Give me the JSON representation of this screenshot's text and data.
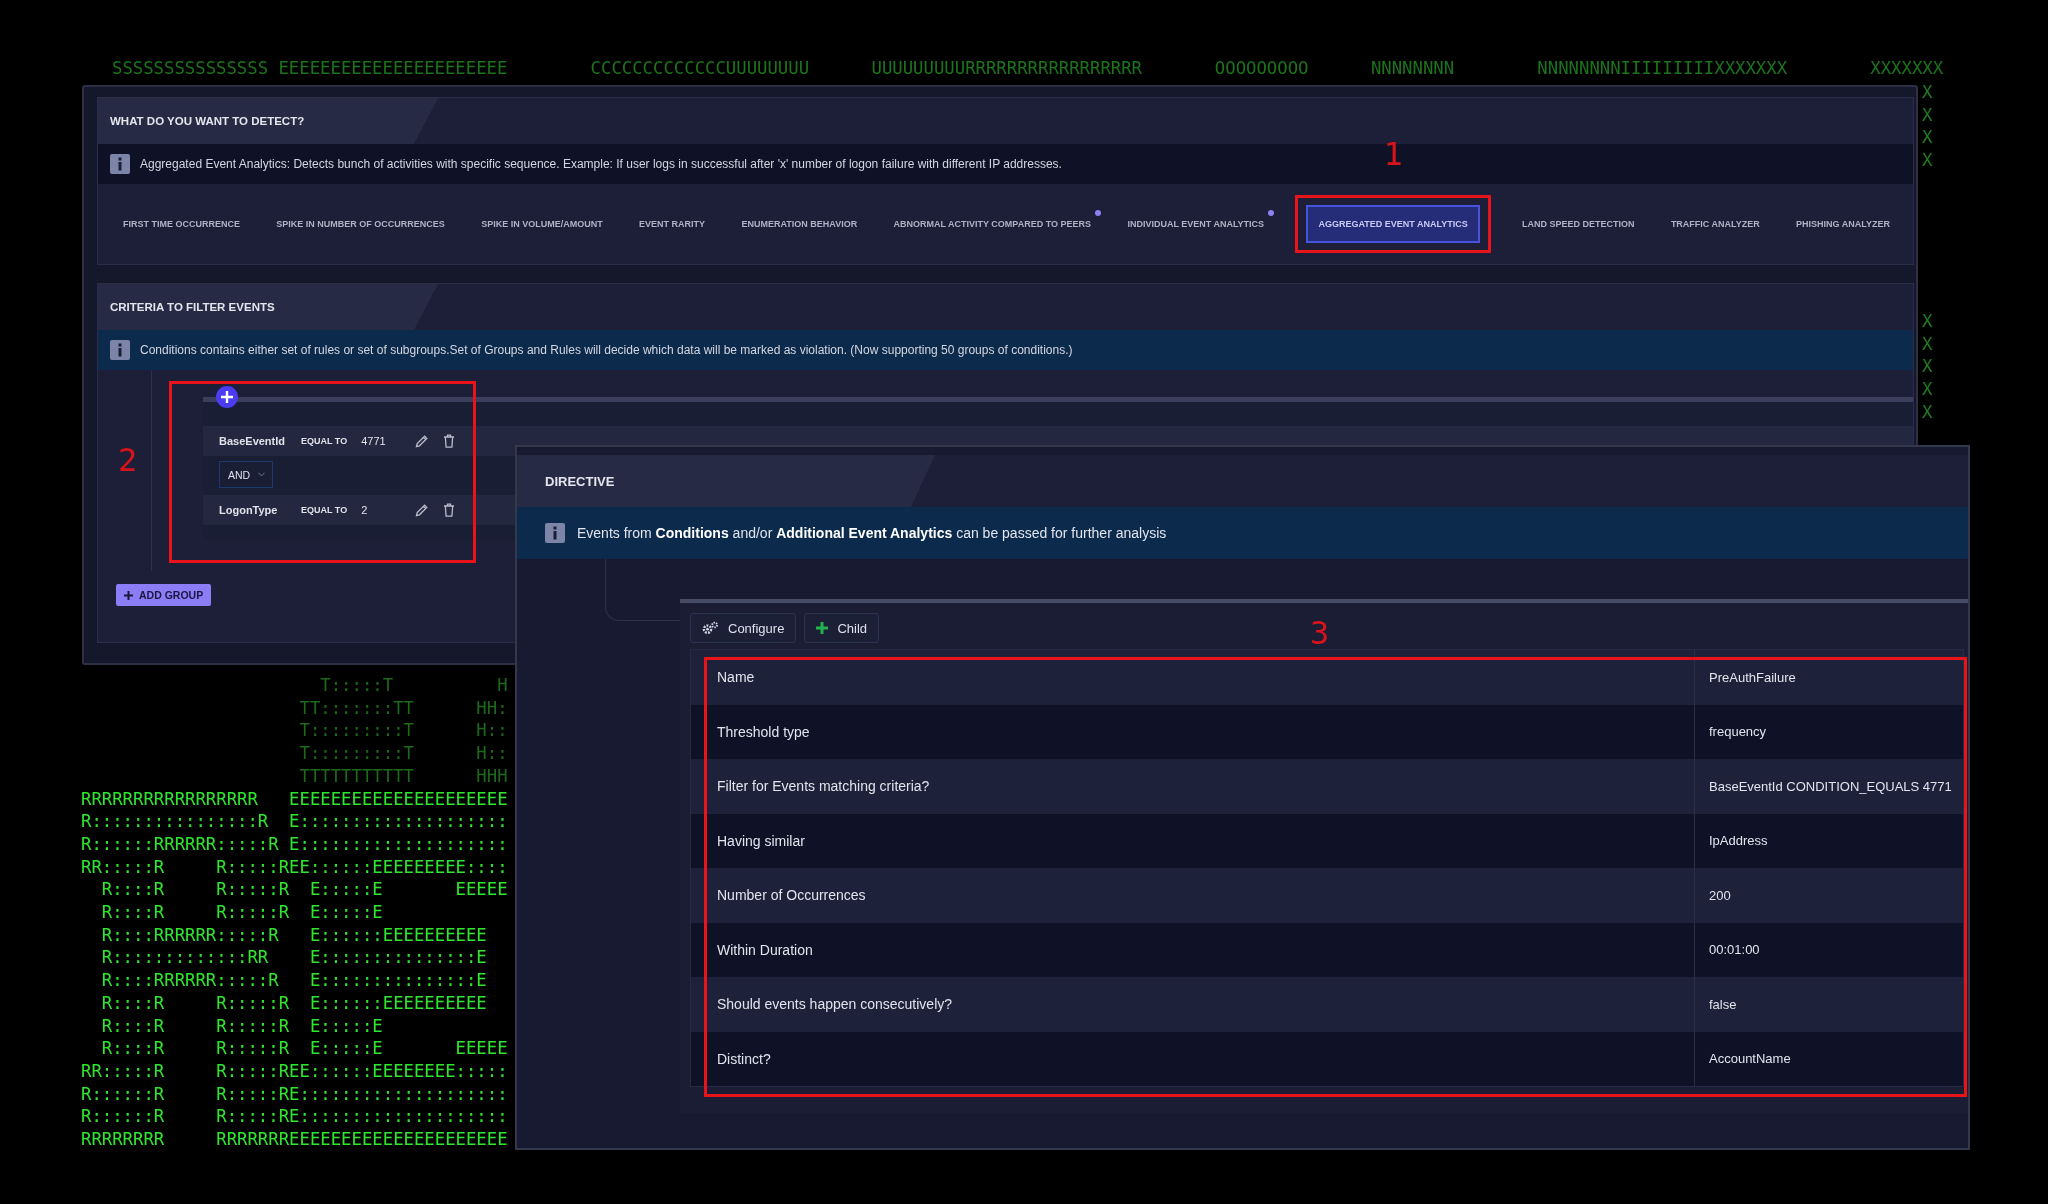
{
  "background_art": {
    "top_row": "SSSSSSSSSSSSSSS EEEEEEEEEEEEEEEEEEEEEE        CCCCCCCCCCCCCUUUUUUUU      UUUUUUUUURRRRRRRRRRRRRRRRR       OOOOOOOOO      NNNNNNNN        NNNNNNNNIIIIIIIIIXXXXXXX        XXXXXXX",
    "x_column_upper": [
      "X",
      "X",
      "X",
      "X"
    ],
    "x_column_lower": [
      "X",
      "X",
      "X",
      "X",
      "X"
    ],
    "block": [
      {
        "text": "                       T:::::T          H",
        "dim": true
      },
      {
        "text": "                     TT:::::::TT      HH:",
        "dim": true
      },
      {
        "text": "                     T:::::::::T      H::",
        "dim": true
      },
      {
        "text": "                     T:::::::::T      H::",
        "dim": true
      },
      {
        "text": "                     TTTTTTTTTTT      HHH",
        "dim": true
      },
      {
        "text": "RRRRRRRRRRRRRRRRR   EEEEEEEEEEEEEEEEEEEEE",
        "dim": false
      },
      {
        "text": "R::::::::::::::::R  E::::::::::::::::::::",
        "dim": false
      },
      {
        "text": "R::::::RRRRRR:::::R E::::::::::::::::::::",
        "dim": false
      },
      {
        "text": "RR:::::R     R:::::REE::::::EEEEEEEEE::::",
        "dim": false
      },
      {
        "text": "  R::::R     R:::::R  E:::::E       EEEEE",
        "dim": false
      },
      {
        "text": "  R::::R     R:::::R  E:::::E",
        "dim": false
      },
      {
        "text": "  R::::RRRRRR:::::R   E::::::EEEEEEEEEE",
        "dim": false
      },
      {
        "text": "  R:::::::::::::RR    E:::::::::::::::E",
        "dim": false
      },
      {
        "text": "  R::::RRRRRR:::::R   E:::::::::::::::E",
        "dim": false
      },
      {
        "text": "  R::::R     R:::::R  E::::::EEEEEEEEEE",
        "dim": false
      },
      {
        "text": "  R::::R     R:::::R  E:::::E",
        "dim": false
      },
      {
        "text": "  R::::R     R:::::R  E:::::E       EEEEE",
        "dim": false
      },
      {
        "text": "RR:::::R     R:::::REE::::::EEEEEEEE:::::",
        "dim": false
      },
      {
        "text": "R::::::R     R:::::RE::::::::::::::::::::",
        "dim": false
      },
      {
        "text": "R::::::R     R:::::RE::::::::::::::::::::",
        "dim": false
      },
      {
        "text": "RRRRRRRR     RRRRRRREEEEEEEEEEEEEEEEEEEEE",
        "dim": false
      }
    ]
  },
  "detect_window": {
    "detect_section": {
      "title": "WHAT DO YOU WANT TO DETECT?",
      "info": "Aggregated Event Analytics: Detects bunch of activities with specific sequence. Example: If user logs in successful after 'x' number of logon failure with different IP addresses.",
      "callout": "1",
      "tabs": [
        {
          "label": "FIRST TIME OCCURRENCE",
          "selected": false,
          "dot": false
        },
        {
          "label": "SPIKE IN NUMBER OF OCCURRENCES",
          "selected": false,
          "dot": false
        },
        {
          "label": "SPIKE IN VOLUME/AMOUNT",
          "selected": false,
          "dot": false
        },
        {
          "label": "EVENT RARITY",
          "selected": false,
          "dot": false
        },
        {
          "label": "ENUMERATION BEHAVIOR",
          "selected": false,
          "dot": false
        },
        {
          "label": "ABNORMAL ACTIVITY COMPARED TO PEERS",
          "selected": false,
          "dot": true
        },
        {
          "label": "INDIVIDUAL EVENT ANALYTICS",
          "selected": false,
          "dot": true
        },
        {
          "label": "AGGREGATED EVENT ANALYTICS",
          "selected": true,
          "dot": false
        },
        {
          "label": "LAND SPEED DETECTION",
          "selected": false,
          "dot": false
        },
        {
          "label": "TRAFFIC ANALYZER",
          "selected": false,
          "dot": false
        },
        {
          "label": "PHISHING ANALYZER",
          "selected": false,
          "dot": false
        }
      ]
    },
    "criteria_section": {
      "title": "CRITERIA TO FILTER EVENTS",
      "info": "Conditions contains either set of rules or set of subgroups.Set of Groups and Rules will decide which data will be marked as violation. (Now supporting 50 groups of conditions.)",
      "callout": "2",
      "rules": [
        {
          "field": "BaseEventId",
          "operator": "EQUAL TO",
          "value": "4771"
        },
        {
          "field": "LogonType",
          "operator": "EQUAL TO",
          "value": "2"
        }
      ],
      "joiner": "AND",
      "add_group_button": "ADD GROUP"
    }
  },
  "directive_window": {
    "title": "DIRECTIVE",
    "info": "Events from **Conditions** and/or **Additional Event Analytics** can be passed for further analysis",
    "callout": "3",
    "toolbar": [
      {
        "label": "Configure",
        "kind": "gear"
      },
      {
        "label": "Child",
        "kind": "plus"
      }
    ],
    "table": {
      "rows": [
        {
          "label": "Name",
          "value": "PreAuthFailure"
        },
        {
          "label": "Threshold type",
          "value": "frequency"
        },
        {
          "label": "Filter for Events matching criteria?",
          "value": "BaseEventId CONDITION_EQUALS 4771"
        },
        {
          "label": "Having similar",
          "value": "IpAddress"
        },
        {
          "label": "Number of Occurrences",
          "value": "200"
        },
        {
          "label": "Within Duration",
          "value": "00:01:00"
        },
        {
          "label": "Should events happen consecutively?",
          "value": "false"
        },
        {
          "label": "Distinct?",
          "value": "AccountName"
        }
      ]
    }
  }
}
